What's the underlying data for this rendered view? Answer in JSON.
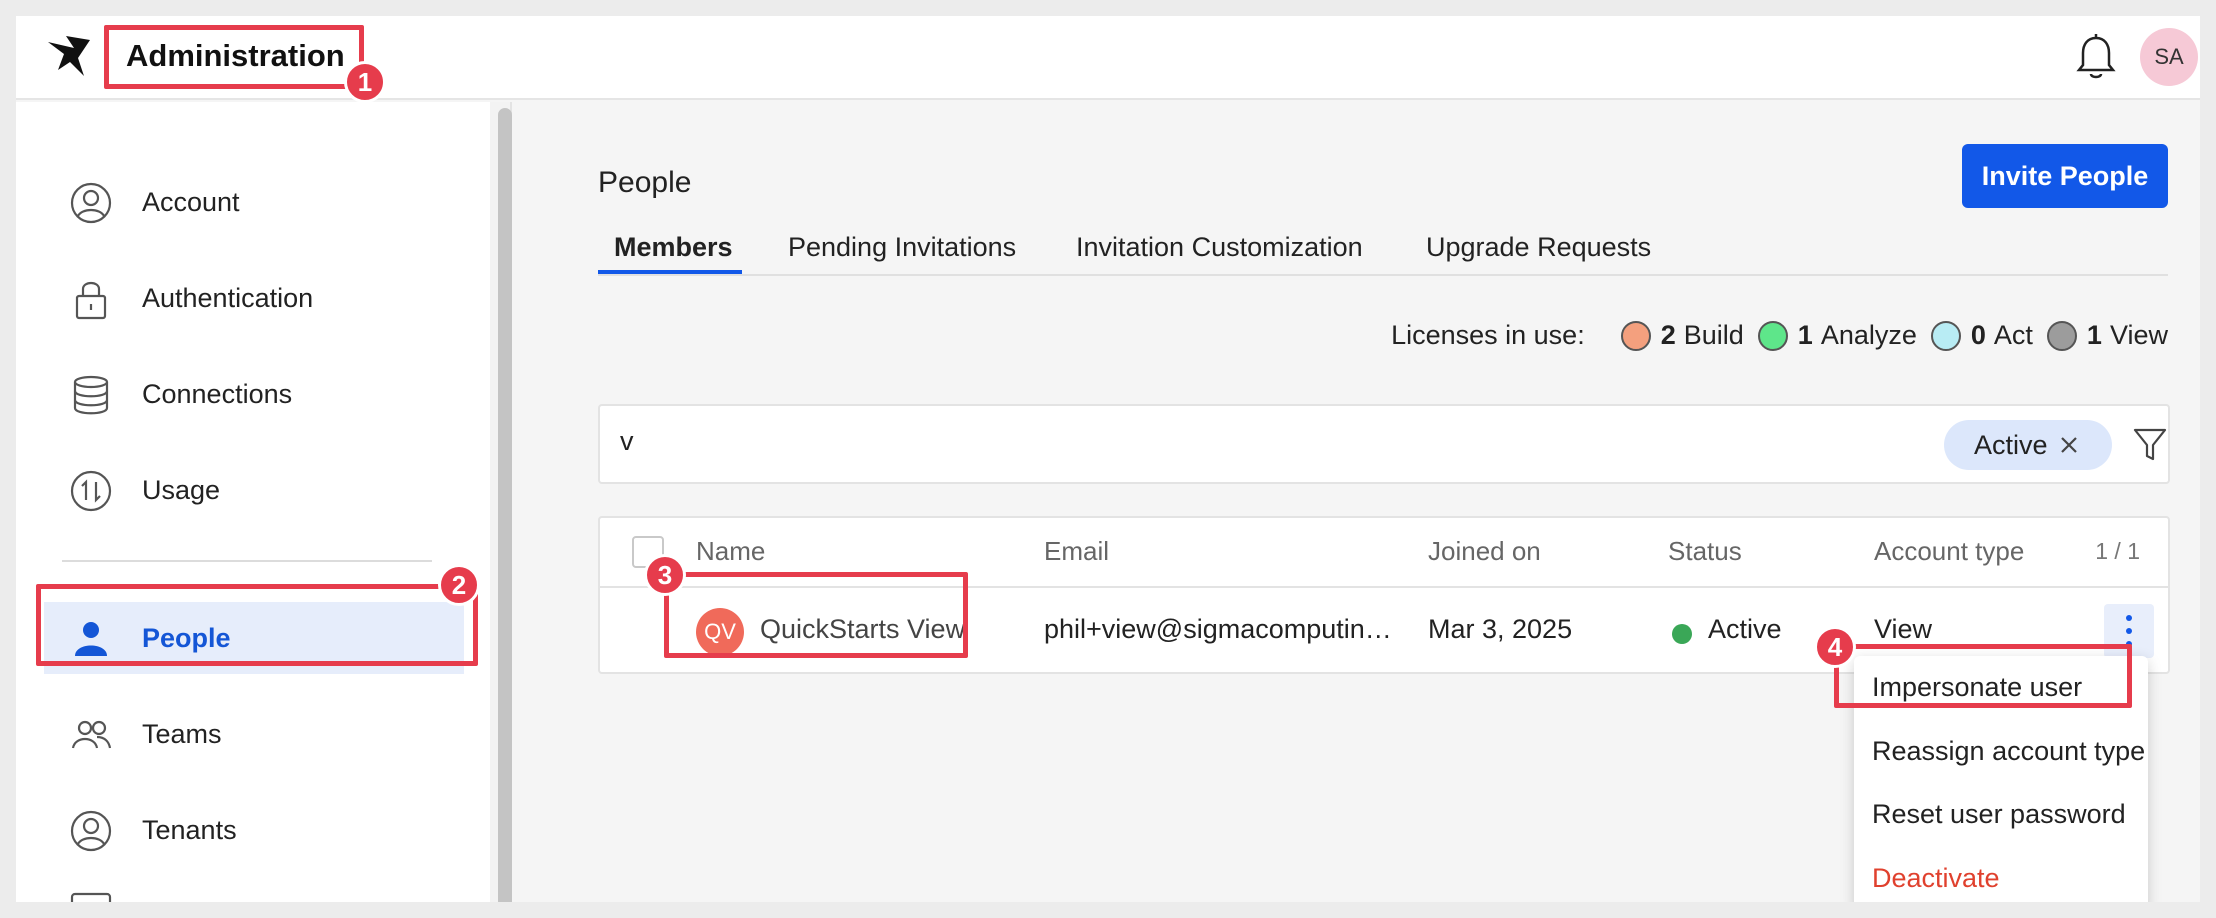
{
  "header": {
    "title": "Administration",
    "user_initials": "SA"
  },
  "sidebar": {
    "items": [
      {
        "label": "Account",
        "icon": "user-circle-icon"
      },
      {
        "label": "Authentication",
        "icon": "lock-icon"
      },
      {
        "label": "Connections",
        "icon": "database-icon"
      },
      {
        "label": "Usage",
        "icon": "usage-arrows-icon"
      },
      {
        "label": "People",
        "icon": "person-icon",
        "active": true
      },
      {
        "label": "Teams",
        "icon": "team-icon"
      },
      {
        "label": "Tenants",
        "icon": "user-circle-icon"
      }
    ]
  },
  "main": {
    "title": "People",
    "invite_label": "Invite People",
    "tabs": [
      "Members",
      "Pending Invitations",
      "Invitation Customization",
      "Upgrade Requests"
    ],
    "licenses": {
      "label": "Licenses in use:",
      "items": [
        {
          "count": "2",
          "type": "Build",
          "color": "#f4a07e"
        },
        {
          "count": "1",
          "type": "Analyze",
          "color": "#5ee68a"
        },
        {
          "count": "0",
          "type": "Act",
          "color": "#b8ecf4"
        },
        {
          "count": "1",
          "type": "View",
          "color": "#9c9c9c"
        }
      ]
    },
    "search": {
      "value": "v",
      "filter_chip": "Active"
    },
    "table": {
      "columns": [
        "Name",
        "Email",
        "Joined on",
        "Status",
        "Account type"
      ],
      "page_count": "1 / 1",
      "rows": [
        {
          "initials": "QV",
          "name": "QuickStarts View",
          "email": "phil+view@sigmacomputin…",
          "joined": "Mar 3, 2025",
          "status": "Active",
          "account_type": "View"
        }
      ]
    },
    "context_menu": [
      "Impersonate user",
      "Reassign account type",
      "Reset user password",
      "Deactivate"
    ]
  },
  "callouts": [
    "1",
    "2",
    "3",
    "4"
  ],
  "colors": {
    "accent": "#1258e8",
    "highlight": "#e63c4c",
    "danger": "#e0412e"
  }
}
